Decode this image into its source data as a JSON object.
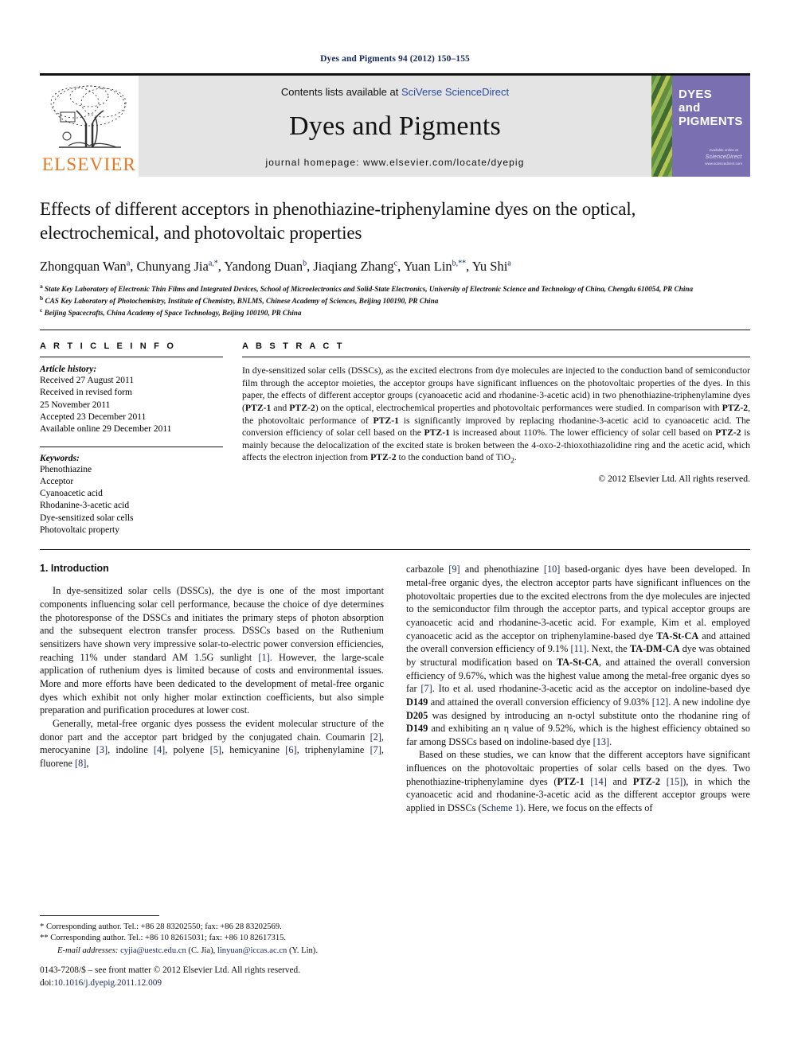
{
  "running_head": "Dyes and Pigments 94 (2012) 150–155",
  "masthead": {
    "publisher_logo_text": "ELSEVIER",
    "contents_prefix": "Contents lists available at ",
    "contents_link": "SciVerse ScienceDirect",
    "journal_title": "Dyes and Pigments",
    "homepage_line": "journal homepage: www.elsevier.com/locate/dyepig",
    "cover_title_line1": "DYES",
    "cover_title_line2": "and",
    "cover_title_line3": "PIGMENTS",
    "cover_footer_small": "Available online at",
    "cover_footer_badge": "ScienceDirect",
    "cover_footer_url": "www.sciencedirect.com"
  },
  "article": {
    "title": "Effects of different acceptors in phenothiazine-triphenylamine dyes on the optical, electrochemical, and photovoltaic properties",
    "authors": "Zhongquan Wan a, Chunyang Jia a,*, Yandong Duan b, Jiaqiang Zhang c, Yuan Lin b,**, Yu Shi a",
    "affiliations": [
      "a State Key Laboratory of Electronic Thin Films and Integrated Devices, School of Microelectronics and Solid-State Electronics, University of Electronic Science and Technology of China, Chengdu 610054, PR China",
      "b CAS Key Laboratory of Photochemistry, Institute of Chemistry, BNLMS, Chinese Academy of Sciences, Beijing 100190, PR China",
      "c Beijing Spacecrafts, China Academy of Space Technology, Beijing 100190, PR China"
    ]
  },
  "article_info": {
    "heading": "A R T I C L E  I N F O",
    "history_label": "Article history:",
    "history": [
      "Received 27 August 2011",
      "Received in revised form",
      "25 November 2011",
      "Accepted 23 December 2011",
      "Available online 29 December 2011"
    ],
    "keywords_label": "Keywords:",
    "keywords": [
      "Phenothiazine",
      "Acceptor",
      "Cyanoacetic acid",
      "Rhodanine-3-acetic acid",
      "Dye-sensitized solar cells",
      "Photovoltaic property"
    ]
  },
  "abstract": {
    "heading": "A B S T R A C T",
    "text_part1": "In dye-sensitized solar cells (DSSCs), as the excited electrons from dye molecules are injected to the conduction band of semiconductor film through the acceptor moieties, the acceptor groups have significant influences on the photovoltaic properties of the dyes. In this paper, the effects of different acceptor groups (cyanoacetic acid and rhodanine-3-acetic acid) in two phenothiazine-triphenylamine dyes (",
    "dye1": "PTZ-1",
    "text_part2": " and ",
    "dye2": "PTZ-2",
    "text_part3": ") on the optical, electrochemical properties and photovoltaic performances were studied. In comparison with ",
    "dye3": "PTZ-2",
    "text_part4": ", the photovoltaic performance of ",
    "dye4": "PTZ-1",
    "text_part5": " is significantly improved by replacing rhodanine-3-acetic acid to cyanoacetic acid. The conversion efficiency of solar cell based on the ",
    "dye5": "PTZ-1",
    "text_part6": " is increased about 110%. The lower efficiency of solar cell based on ",
    "dye6": "PTZ-2",
    "text_part7": " is mainly because the delocalization of the excited state is broken between the 4-oxo-2-thioxothiazolidine ring and the acetic acid, which affects the electron injection from ",
    "dye7": "PTZ-2",
    "text_part8": " to the conduction band of TiO2.",
    "copyright": "© 2012 Elsevier Ltd. All rights reserved."
  },
  "body": {
    "section_heading": "1. Introduction",
    "left_para1_a": "In dye-sensitized solar cells (DSSCs), the dye is one of the most important components influencing solar cell performance, because the choice of dye determines the photoresponse of the DSSCs and initiates the primary steps of photon absorption and the subsequent electron transfer process. DSSCs based on the Ruthenium sensitizers have shown very impressive solar-to-electric power conversion efficiencies, reaching 11% under standard AM 1.5G sunlight ",
    "left_para1_ref1": "[1]",
    "left_para1_b": ". However, the large-scale application of ruthenium dyes is limited because of costs and environmental issues. More and more efforts have been dedicated to the development of metal-free organic dyes which exhibit not only higher molar extinction coefficients, but also simple preparation and purification procedures at lower cost.",
    "left_para2_a": "Generally, metal-free organic dyes possess the evident molecular structure of the donor part and the acceptor part bridged by the conjugated chain. Coumarin ",
    "left_para2_ref2": "[2]",
    "left_para2_b": ", merocyanine ",
    "left_para2_ref3": "[3]",
    "left_para2_c": ", indoline ",
    "left_para2_ref4": "[4]",
    "left_para2_d": ", polyene ",
    "left_para2_ref5": "[5]",
    "left_para2_e": ", hemicyanine ",
    "left_para2_ref6": "[6]",
    "left_para2_f": ", triphenylamine ",
    "left_para2_ref7": "[7]",
    "left_para2_g": ", fluorene ",
    "left_para2_ref8": "[8]",
    "left_para2_h": ",",
    "right_para1_a": "carbazole ",
    "right_para1_ref9": "[9]",
    "right_para1_b": " and phenothiazine ",
    "right_para1_ref10": "[10]",
    "right_para1_c": " based-organic dyes have been developed. In metal-free organic dyes, the electron acceptor parts have significant influences on the photovoltaic properties due to the excited electrons from the dye molecules are injected to the semiconductor film through the acceptor parts, and typical acceptor groups are cyanoacetic acid and rhodanine-3-acetic acid. For example, Kim et al. employed cyanoacetic acid as the acceptor on triphenylamine-based dye ",
    "right_para1_dye1": "TA-St-CA",
    "right_para1_d": " and attained the overall conversion efficiency of 9.1% ",
    "right_para1_ref11": "[11]",
    "right_para1_e": ". Next, the ",
    "right_para1_dye2": "TA-DM-CA",
    "right_para1_f": " dye was obtained by structural modification based on ",
    "right_para1_dye3": "TA-St-CA",
    "right_para1_g": ", and attained the overall conversion efficiency of 9.67%, which was the highest value among the metal-free organic dyes so far ",
    "right_para1_ref7": "[7]",
    "right_para1_h": ". Ito et al. used rhodanine-3-acetic acid as the acceptor on indoline-based dye ",
    "right_para1_dye4": "D149",
    "right_para1_i": " and attained the overall conversion efficiency of 9.03% ",
    "right_para1_ref12": "[12]",
    "right_para1_j": ". A new indoline dye ",
    "right_para1_dye5": "D205",
    "right_para1_k": " was designed by introducing an n-octyl substitute onto the rhodanine ring of ",
    "right_para1_dye6": "D149",
    "right_para1_l": " and exhibiting an η value of 9.52%, which is the highest efficiency obtained so far among DSSCs based on indoline-based dye ",
    "right_para1_ref13": "[13]",
    "right_para1_m": ".",
    "right_para2_a": "Based on these studies, we can know that the different acceptors have significant influences on the photovoltaic properties of solar cells based on the dyes. Two phenothiazine-triphenylamine dyes (",
    "right_para2_dye1": "PTZ-1",
    "right_para2_b": " ",
    "right_para2_ref14": "[14]",
    "right_para2_c": " and ",
    "right_para2_dye2": "PTZ-2",
    "right_para2_d": " ",
    "right_para2_ref15": "[15]",
    "right_para2_e": "), in which the cyanoacetic acid and rhodanine-3-acetic acid as the different acceptor groups were applied in DSSCs (",
    "right_para2_scheme": "Scheme 1",
    "right_para2_f": "). Here, we focus on the effects of"
  },
  "footnotes": {
    "corr1": "* Corresponding author. Tel.: +86 28 83202550; fax: +86 28 83202569.",
    "corr2": "** Corresponding author. Tel.: +86 10 82615031; fax: +86 10 82617315.",
    "email_label": "E-mail addresses:",
    "email1": "cyjia@uestc.edu.cn",
    "email1_owner": "(C. Jia),",
    "email2": "linyuan@iccas.ac.cn",
    "email2_owner": "(Y. Lin)."
  },
  "imprint": {
    "line1": "0143-7208/$ – see front matter © 2012 Elsevier Ltd. All rights reserved.",
    "doi_label": "doi:",
    "doi_value": "10.1016/j.dyepig.2011.12.009"
  },
  "colors": {
    "link": "#1b2a63",
    "sciencedirect": "#2b4a9b",
    "elsevier_orange": "#E87722",
    "masthead_bg": "#e4e4e4",
    "cover_purple": "#7a6fb0"
  }
}
